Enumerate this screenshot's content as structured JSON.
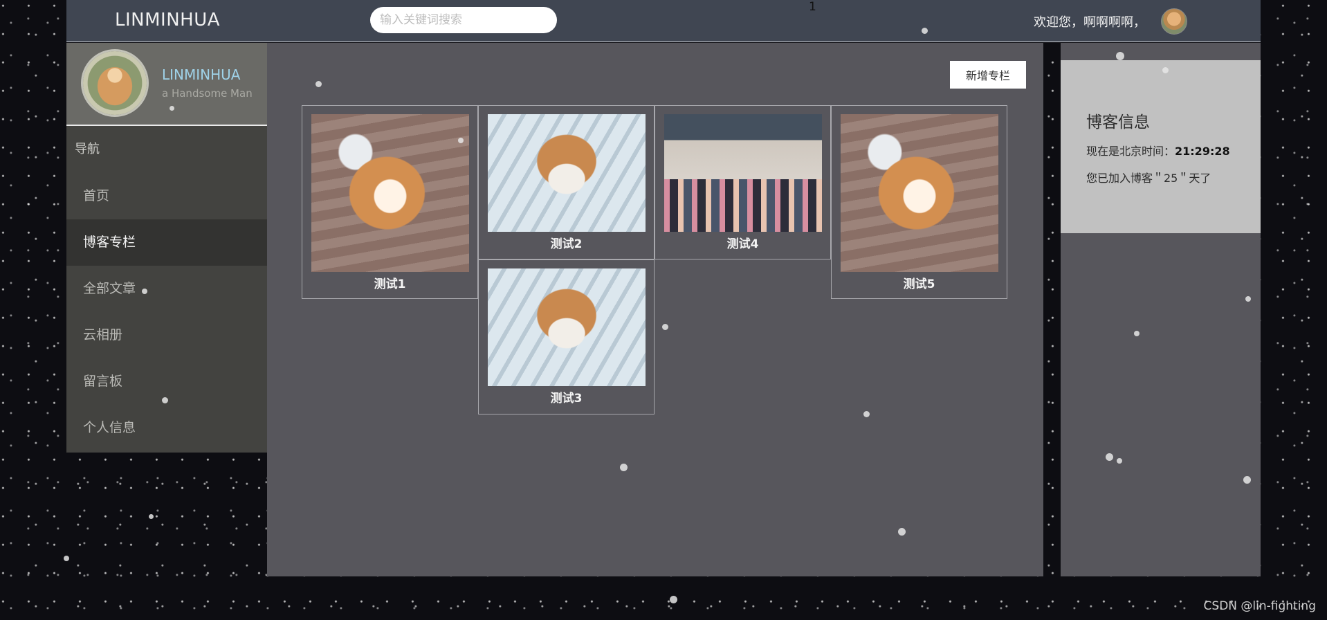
{
  "header": {
    "brand": "LINMINHUA",
    "search_placeholder": "输入关键词搜索",
    "page_number": "1",
    "welcome": "欢迎您，啊啊啊啊，"
  },
  "sidebar": {
    "profile_name": "LINMINHUA",
    "profile_tagline": "a Handsome Man",
    "nav_heading": "导航",
    "items": [
      {
        "label": "首页"
      },
      {
        "label": "博客专栏"
      },
      {
        "label": "全部文章"
      },
      {
        "label": "云相册"
      },
      {
        "label": "留言板"
      },
      {
        "label": "个人信息"
      }
    ]
  },
  "main": {
    "add_button": "新增专栏",
    "columns": [
      {
        "title": "测试1"
      },
      {
        "title": "测试2"
      },
      {
        "title": "测试3"
      },
      {
        "title": "测试4"
      },
      {
        "title": "测试5"
      }
    ]
  },
  "blog_info": {
    "title": "博客信息",
    "time_label": "现在是北京时间：",
    "time_value": "21:29:28",
    "days_text": "您已加入博客＂25＂天了"
  },
  "watermark": "CSDN @lin-fighting"
}
